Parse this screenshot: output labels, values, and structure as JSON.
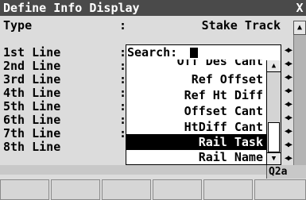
{
  "window": {
    "title": "Define Info Display",
    "close_glyph": "X"
  },
  "type_row": {
    "label": "Type",
    "colon": ":",
    "value": "Stake Track"
  },
  "lines": [
    {
      "label": "1st Line",
      "colon": ":"
    },
    {
      "label": "2nd Line",
      "colon": ":"
    },
    {
      "label": "3rd Line",
      "colon": ":"
    },
    {
      "label": "4th Line",
      "colon": ":"
    },
    {
      "label": "5th Line",
      "colon": ":"
    },
    {
      "label": "6th Line",
      "colon": ":"
    },
    {
      "label": "7th Line",
      "colon": ":"
    },
    {
      "label": "8th Line",
      "colon": ":"
    }
  ],
  "dropdown": {
    "search_label": "Search:",
    "partial_item": "Off Des Cant",
    "items": [
      "Ref Offset",
      "Ref Ht Diff",
      "Offset Cant",
      "HtDiff Cant",
      "Rail Task",
      "Rail Name"
    ],
    "selected": "Rail Task"
  },
  "status": {
    "mode": "Q2a"
  },
  "softkeys": [
    "",
    "",
    "",
    "",
    "",
    ""
  ],
  "icons": {
    "close": "close-icon",
    "scroll_up": "scroll-up-icon",
    "scroll_down": "scroll-down-icon",
    "left_right": "left-right-arrows-icon"
  }
}
